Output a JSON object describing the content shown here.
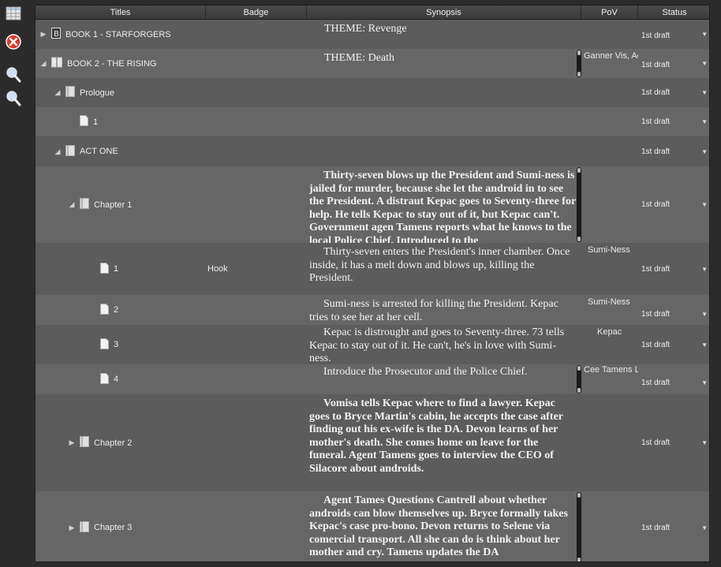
{
  "header": {
    "titles": "Titles",
    "badge": "Badge",
    "synopsis": "Synopsis",
    "pov": "PoV",
    "status": "Status"
  },
  "rows": [
    {
      "title": "BOOK 1 - STARFORGERS",
      "caret": "▶",
      "icon": "book-b-icon",
      "badge": "",
      "synopsis": "THEME: Revenge",
      "pov": "",
      "status": "1st draft"
    },
    {
      "title": "BOOK 2 - THE RISING",
      "caret": "◢",
      "icon": "book-open-icon",
      "badge": "",
      "synopsis": "THEME: Death",
      "pov": "Ganner Vis, Ac",
      "status": "1st draft"
    },
    {
      "title": "Prologue",
      "caret": "◢",
      "icon": "folder-icon",
      "badge": "",
      "synopsis": "",
      "pov": "",
      "status": "1st draft"
    },
    {
      "title": "1",
      "caret": "",
      "icon": "document-icon",
      "badge": "",
      "synopsis": "",
      "pov": "",
      "status": "1st draft"
    },
    {
      "title": "ACT ONE",
      "caret": "◢",
      "icon": "folder-icon",
      "badge": "",
      "synopsis": "",
      "pov": "",
      "status": "1st draft"
    },
    {
      "title": "Chapter 1",
      "caret": "◢",
      "icon": "folder-icon",
      "badge": "",
      "synopsis": "Thirty-seven blows up the President and Sumi-ness is jailed for murder, because she let the android in to see the President. A distraut Kepac goes to Seventy-three for help. He tells Kepac to stay out of it, but Kepac can't. Government agen Tamens reports what he knows to the local Police Chief. Introduced to the",
      "pov": "",
      "status": "1st draft"
    },
    {
      "title": "1",
      "caret": "",
      "icon": "document-icon",
      "badge": "Hook",
      "synopsis": "Thirty-seven enters the President's inner chamber. Once inside, it has a melt down and blows up, killing the President.",
      "pov": "Sumi-Ness",
      "status": "1st draft"
    },
    {
      "title": "2",
      "caret": "",
      "icon": "document-icon",
      "badge": "",
      "synopsis": "Sumi-ness is arrested for killing the President. Kepac tries to see her at her cell.",
      "pov": "Sumi-Ness",
      "status": "1st draft"
    },
    {
      "title": "3",
      "caret": "",
      "icon": "document-icon",
      "badge": "",
      "synopsis": "Kepac is distrought and goes to Seventy-three. 73 tells Kepac to stay out of it. He can't, he's in love with Sumi-ness.",
      "pov": "Kepac",
      "status": "1st draft"
    },
    {
      "title": "4",
      "caret": "",
      "icon": "document-icon",
      "badge": "",
      "synopsis": "Introduce the Prosecutor and the Police Chief.",
      "pov": "Cee Tamens Li",
      "status": "1st draft"
    },
    {
      "title": "Chapter 2",
      "caret": "▶",
      "icon": "folder-icon",
      "badge": "",
      "synopsis": "Vomisa tells Kepac where to find a lawyer. Kepac goes to Bryce Martin's cabin, he accepts the case after finding out his ex-wife is the DA. Devon learns of her mother's death. She comes home on leave for the funeral. Agent Tamens goes to interview the CEO of Silacore about androids.",
      "pov": "",
      "status": "1st draft"
    },
    {
      "title": "Chapter 3",
      "caret": "▶",
      "icon": "folder-icon",
      "badge": "",
      "synopsis": "Agent Tames Questions Cantrell about whether androids can blow themselves up. Bryce formally takes Kepac's case pro-bono. Devon returns to Selene via comercial transport. All she can do is think about her mother and cry. Tamens updates the DA",
      "pov": "",
      "status": "1st draft"
    }
  ],
  "toolbar": {
    "icons": [
      "table-view-icon",
      "close-icon",
      "zoom-in-icon",
      "zoom-out-icon"
    ]
  }
}
